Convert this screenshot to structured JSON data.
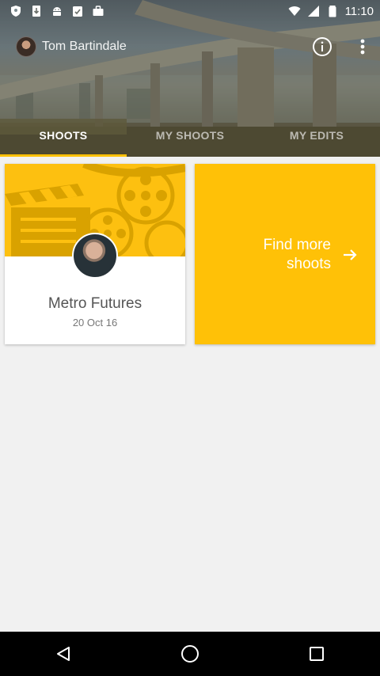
{
  "status_bar": {
    "time": "11:10",
    "icons": [
      "shield-icon",
      "download-icon",
      "android-icon",
      "clipboard-check-icon",
      "briefcase-icon",
      "wifi-icon",
      "signal-icon",
      "battery-icon"
    ]
  },
  "header": {
    "user_name": "Tom Bartindale",
    "info_icon": "info-icon",
    "more_icon": "more-vert-icon"
  },
  "tabs": [
    {
      "label": "SHOOTS",
      "active": true
    },
    {
      "label": "MY SHOOTS",
      "active": false
    },
    {
      "label": "MY EDITS",
      "active": false
    }
  ],
  "cards": {
    "shoot": {
      "title": "Metro Futures",
      "date": "20 Oct 16"
    },
    "find_more": {
      "line1": "Find more",
      "line2": "shoots",
      "icon": "arrow-right-icon"
    }
  },
  "nav_bar": {
    "back": "back-icon",
    "home": "home-icon",
    "recents": "recents-icon"
  },
  "colors": {
    "accent": "#ffc107",
    "background": "#f1f1f1"
  }
}
